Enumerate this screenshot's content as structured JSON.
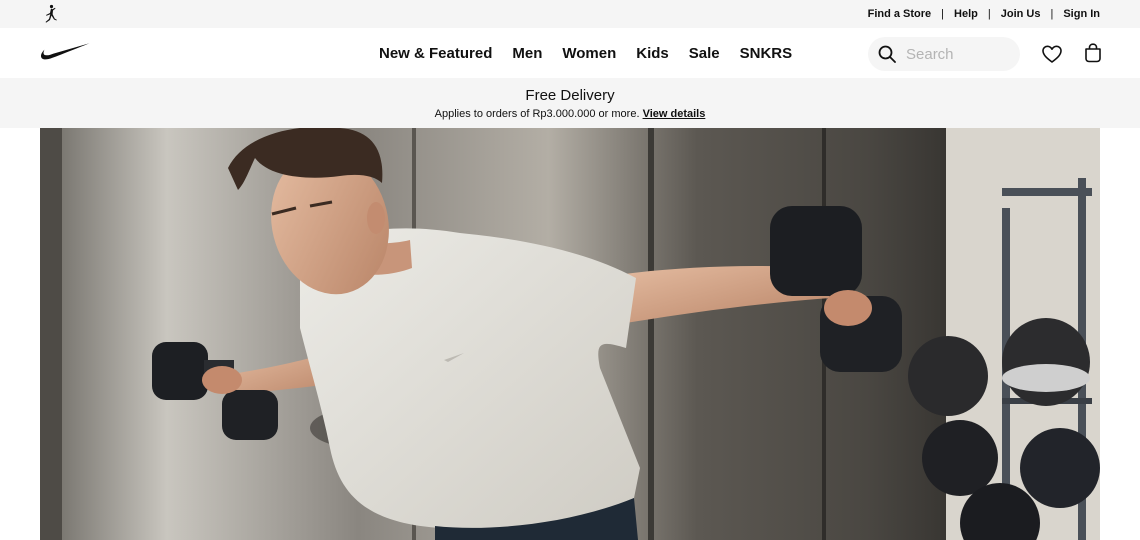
{
  "utility_bar": {
    "links": [
      {
        "label": "Find a Store"
      },
      {
        "label": "Help"
      },
      {
        "label": "Join Us"
      },
      {
        "label": "Sign In"
      }
    ],
    "logo_icon": "jordan-jumpman-icon"
  },
  "nav": {
    "logo_icon": "nike-swoosh-icon",
    "items": [
      {
        "label": "New & Featured"
      },
      {
        "label": "Men"
      },
      {
        "label": "Women"
      },
      {
        "label": "Kids"
      },
      {
        "label": "Sale"
      },
      {
        "label": "SNKRS"
      }
    ],
    "search": {
      "placeholder": "Search",
      "value": ""
    },
    "icons": [
      "search-icon",
      "heart-icon",
      "bag-icon"
    ]
  },
  "promo": {
    "title": "Free Delivery",
    "subtitle": "Applies to orders of Rp3.000.000 or more.",
    "link_label": "View details"
  },
  "hero": {
    "image": "man-lifting-dumbbells-photo"
  },
  "colors": {
    "bar_bg": "#f5f5f5",
    "text": "#111111",
    "placeholder": "#b4b4b4"
  }
}
